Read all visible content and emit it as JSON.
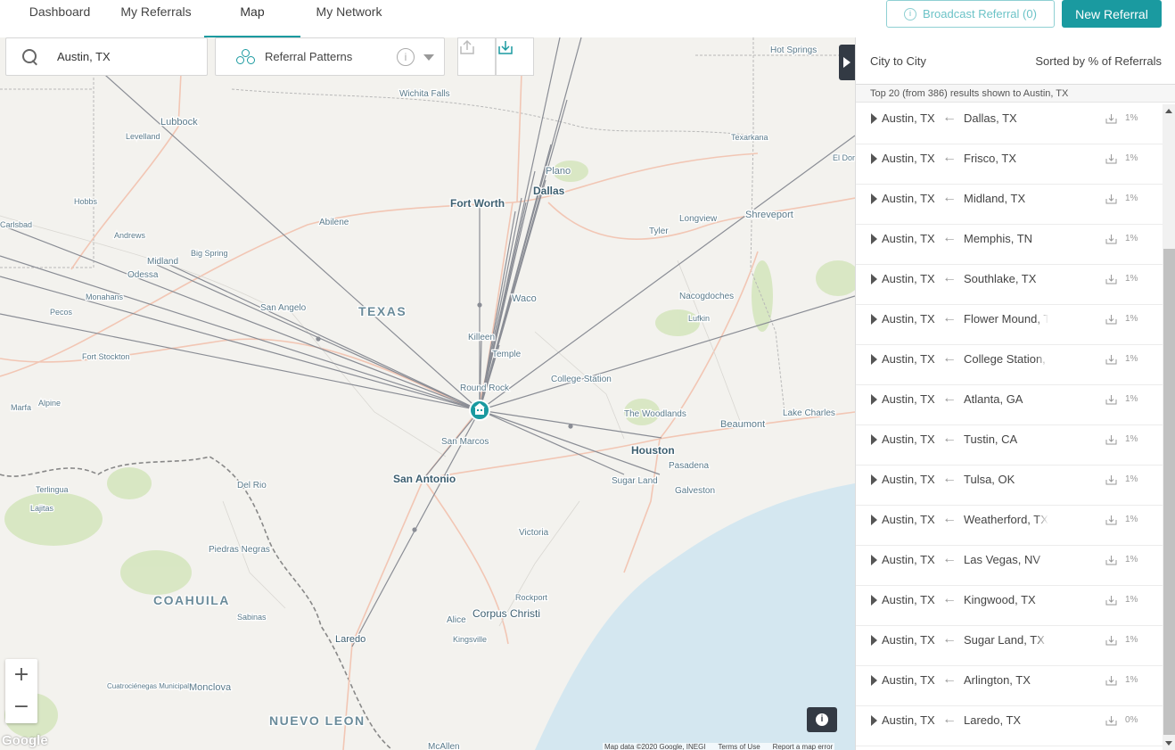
{
  "nav": {
    "tabs": [
      {
        "label": "Dashboard"
      },
      {
        "label": "My Referrals"
      },
      {
        "label": "Map"
      },
      {
        "label": "My Network"
      }
    ],
    "broadcast_label": "Broadcast Referral (0)",
    "new_referral_label": "New Referral"
  },
  "map": {
    "search_value": "Austin, TX",
    "pattern_label": "Referral Patterns",
    "zoom_in": "+",
    "zoom_out": "−",
    "info_glyph": "i",
    "google_logo": "Google",
    "attribution": [
      "Map data ©2020 Google, INEGI",
      "Terms of Use",
      "Report a map error"
    ],
    "labels": [
      {
        "text": "Lubbock"
      },
      {
        "text": "Levelland"
      },
      {
        "text": "Wichita Falls"
      },
      {
        "text": "Hot Springs"
      },
      {
        "text": "Texarkana"
      },
      {
        "text": "El Dora"
      },
      {
        "text": "Plano"
      },
      {
        "text": "Dallas"
      },
      {
        "text": "Fort Worth"
      },
      {
        "text": "Hobbs"
      },
      {
        "text": "Abilene"
      },
      {
        "text": "Longview"
      },
      {
        "text": "Shreveport"
      },
      {
        "text": "Tyler"
      },
      {
        "text": "Andrews"
      },
      {
        "text": "Big Spring"
      },
      {
        "text": "Midland"
      },
      {
        "text": "Odessa"
      },
      {
        "text": "Carlsbad"
      },
      {
        "text": "Monahans"
      },
      {
        "text": "Pecos"
      },
      {
        "text": "San Angelo"
      },
      {
        "text": "TEXAS"
      },
      {
        "text": "Waco"
      },
      {
        "text": "Nacogdoches"
      },
      {
        "text": "Lufkin"
      },
      {
        "text": "Killeen"
      },
      {
        "text": "Temple"
      },
      {
        "text": "Fort Stockton"
      },
      {
        "text": "Round Rock"
      },
      {
        "text": "College Station"
      },
      {
        "text": "Marfa"
      },
      {
        "text": "Alpine"
      },
      {
        "text": "The Woodlands"
      },
      {
        "text": "Beaumont"
      },
      {
        "text": "Lake Charles"
      },
      {
        "text": "San Marcos"
      },
      {
        "text": "Houston"
      },
      {
        "text": "Pasadena"
      },
      {
        "text": "Terlingua"
      },
      {
        "text": "Lajitas"
      },
      {
        "text": "Del Rio"
      },
      {
        "text": "San Antonio"
      },
      {
        "text": "Sugar Land"
      },
      {
        "text": "Galveston"
      },
      {
        "text": "Piedras Negras"
      },
      {
        "text": "Victoria"
      },
      {
        "text": "COAHUILA"
      },
      {
        "text": "Sabinas"
      },
      {
        "text": "Rockport"
      },
      {
        "text": "Corpus Christi"
      },
      {
        "text": "Alice"
      },
      {
        "text": "Kingsville"
      },
      {
        "text": "Laredo"
      },
      {
        "text": "Cuatrociénegas Municipality"
      },
      {
        "text": "Monclova"
      },
      {
        "text": "NUEVO LEON"
      },
      {
        "text": "McAllen"
      }
    ]
  },
  "panel": {
    "title": "City to City",
    "sort_label": "Sorted by % of Referrals",
    "subtitle": "Top 20 (from 386) results shown to Austin, TX",
    "arrow_glyph": "←",
    "rows": [
      {
        "to": "Austin, TX",
        "from": "Dallas, TX",
        "pct": "1%"
      },
      {
        "to": "Austin, TX",
        "from": "Frisco, TX",
        "pct": "1%"
      },
      {
        "to": "Austin, TX",
        "from": "Midland, TX",
        "pct": "1%"
      },
      {
        "to": "Austin, TX",
        "from": "Memphis, TN",
        "pct": "1%"
      },
      {
        "to": "Austin, TX",
        "from": "Southlake, TX",
        "pct": "1%"
      },
      {
        "to": "Austin, TX",
        "from": "Flower Mound, TX",
        "pct": "1%"
      },
      {
        "to": "Austin, TX",
        "from": "College Station, TX",
        "pct": "1%"
      },
      {
        "to": "Austin, TX",
        "from": "Atlanta, GA",
        "pct": "1%"
      },
      {
        "to": "Austin, TX",
        "from": "Tustin, CA",
        "pct": "1%"
      },
      {
        "to": "Austin, TX",
        "from": "Tulsa, OK",
        "pct": "1%"
      },
      {
        "to": "Austin, TX",
        "from": "Weatherford, TX",
        "pct": "1%"
      },
      {
        "to": "Austin, TX",
        "from": "Las Vegas, NV",
        "pct": "1%"
      },
      {
        "to": "Austin, TX",
        "from": "Kingwood, TX",
        "pct": "1%"
      },
      {
        "to": "Austin, TX",
        "from": "Sugar Land, TX",
        "pct": "1%"
      },
      {
        "to": "Austin, TX",
        "from": "Arlington, TX",
        "pct": "1%"
      },
      {
        "to": "Austin, TX",
        "from": "Laredo, TX",
        "pct": "0%"
      }
    ]
  },
  "colors": {
    "accent": "#1a9aa0",
    "dark": "#333a44",
    "route": "#8a8d95"
  }
}
